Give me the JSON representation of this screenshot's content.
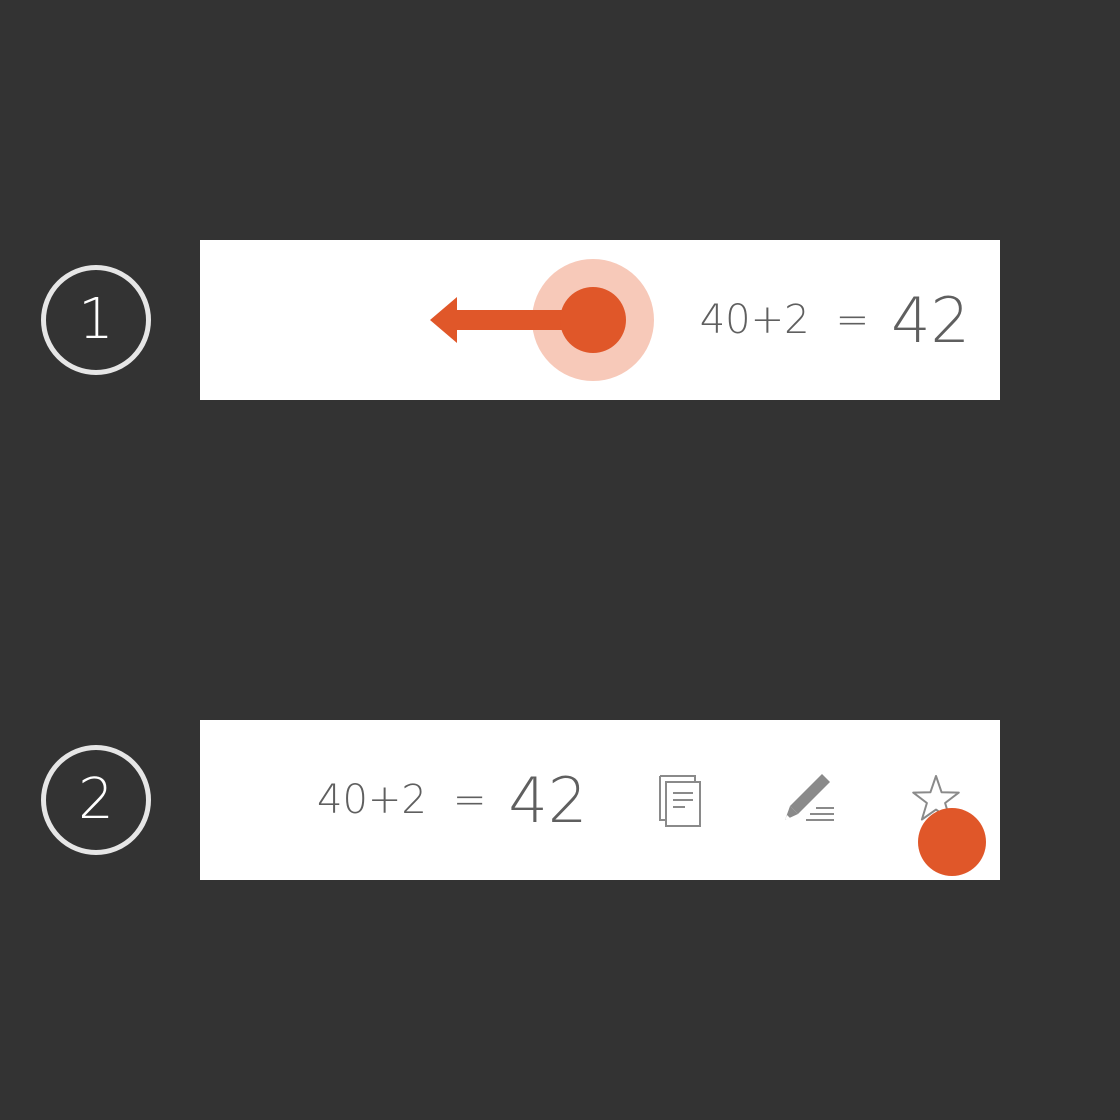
{
  "steps": [
    {
      "number": "1",
      "expression": {
        "input": "40+2",
        "equals": "=",
        "result": "42"
      },
      "gesture": "swipe-left"
    },
    {
      "number": "2",
      "expression": {
        "input": "40+2",
        "equals": "=",
        "result": "42"
      },
      "actions": [
        {
          "icon": "copy-icon"
        },
        {
          "icon": "edit-icon"
        },
        {
          "icon": "star-icon"
        }
      ],
      "gesture": "tap"
    }
  ],
  "colors": {
    "background": "#333333",
    "card": "#ffffff",
    "accent": "#e05729",
    "accent_halo": "#f7c9b9",
    "text": "#5f5f5f",
    "icon": "#8a8a8a",
    "badge_ring": "#e6e6e6"
  }
}
